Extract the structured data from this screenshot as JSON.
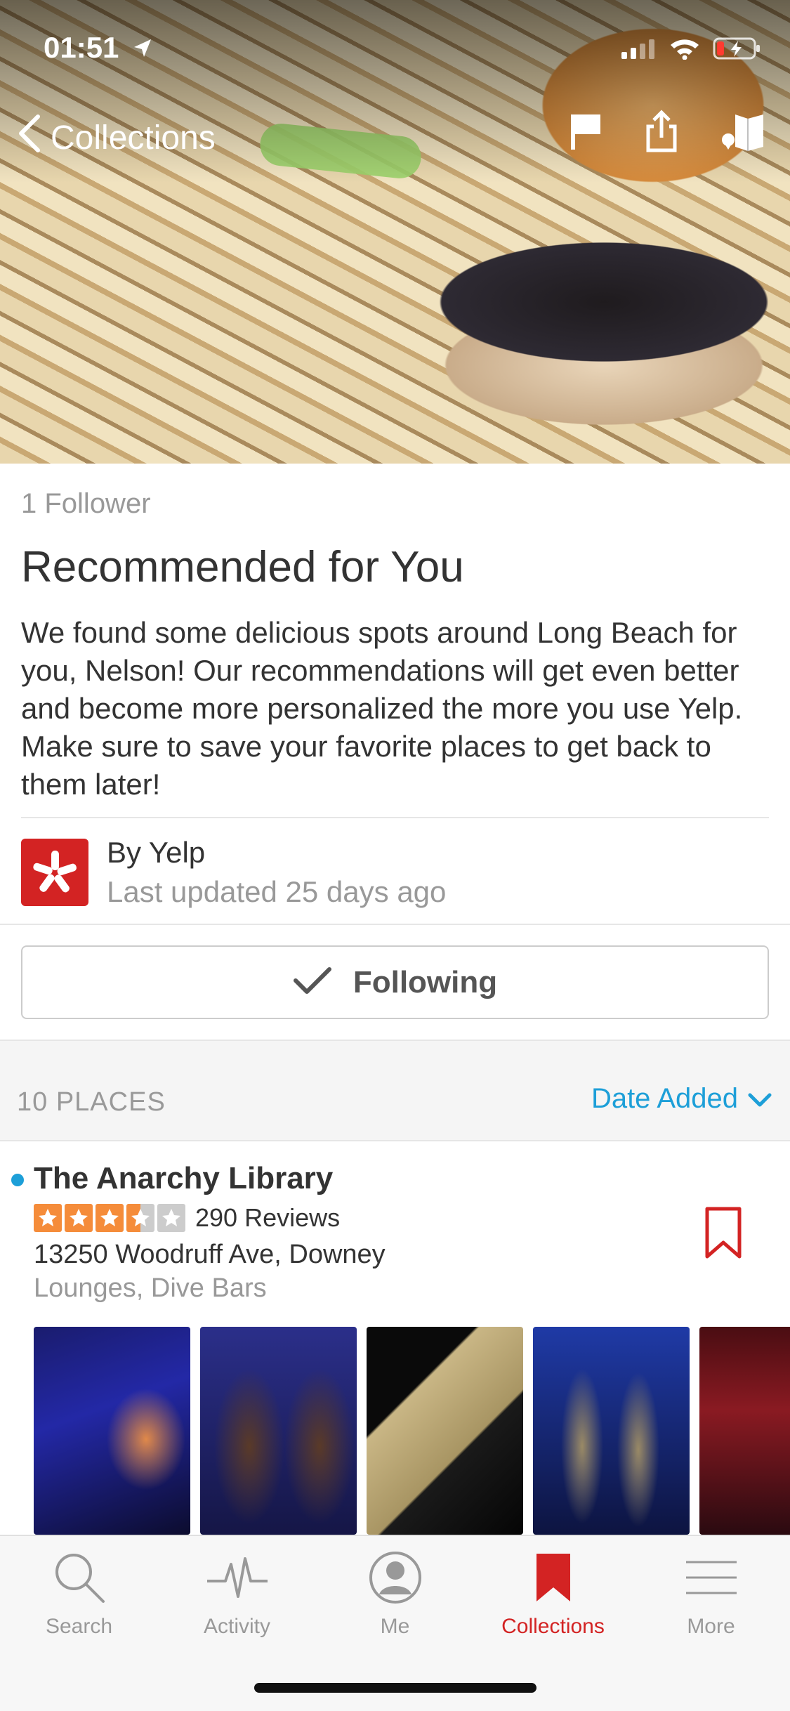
{
  "status_bar": {
    "time": "01:51"
  },
  "nav": {
    "back_label": "Collections"
  },
  "collection": {
    "followers": "1 Follower",
    "title": "Recommended for You",
    "description": "We found some delicious spots around Long Beach for you, Nelson! Our recommendations will get even better and become more personalized the more you use Yelp. Make sure to save your favorite places to get back to them later!",
    "author": "By Yelp",
    "last_updated": "Last updated 25 days ago",
    "follow_button_label": "Following"
  },
  "places_bar": {
    "count_label": "10 PLACES",
    "sort_label": "Date Added"
  },
  "business": {
    "name": "The Anarchy Library",
    "rating": 3.5,
    "review_count": "290 Reviews",
    "address": "13250 Woodruff Ave, Downey",
    "categories": "Lounges, Dive Bars"
  },
  "tabs": [
    {
      "label": "Search",
      "icon": "search-icon"
    },
    {
      "label": "Activity",
      "icon": "activity-icon"
    },
    {
      "label": "Me",
      "icon": "profile-icon"
    },
    {
      "label": "Collections",
      "icon": "bookmark-icon",
      "active": true
    },
    {
      "label": "More",
      "icon": "menu-icon"
    }
  ],
  "colors": {
    "brand_red": "#d32323",
    "link_blue": "#1d9fd8",
    "star_orange": "#f58c3a"
  }
}
